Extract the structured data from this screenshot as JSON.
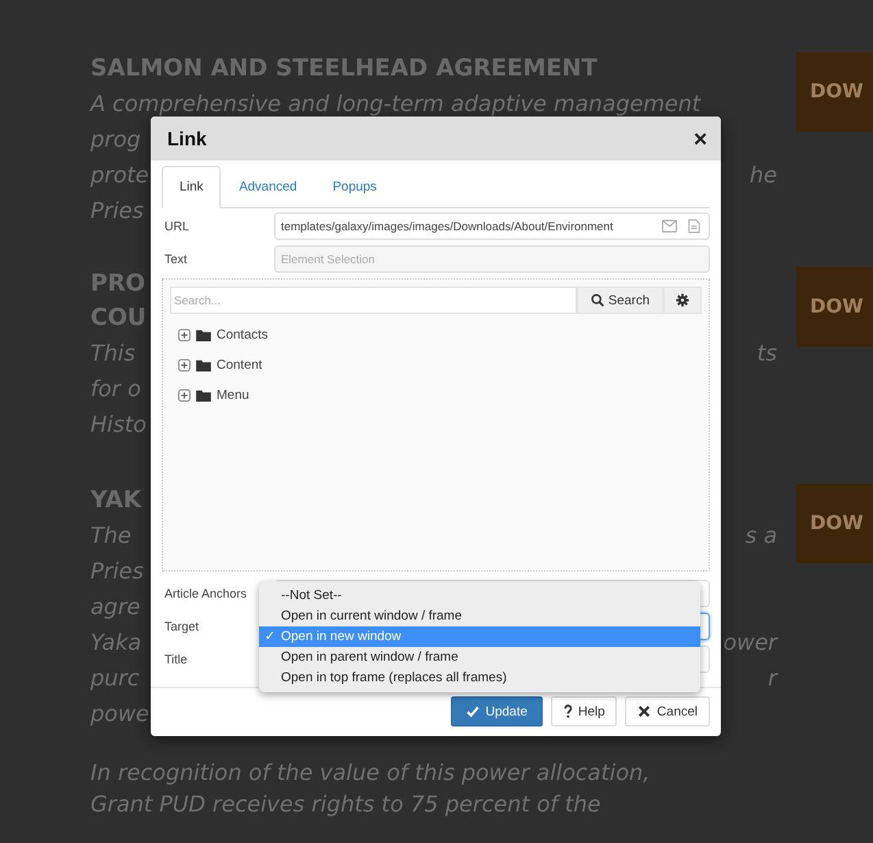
{
  "page": {
    "sections": [
      {
        "heading": [
          "SALMON AND STEELHEAD AGREEMENT"
        ],
        "lines": [
          {
            "left": "A comprehensive and long-term adaptive management"
          },
          {
            "left": "prog"
          },
          {
            "left": "prote",
            "right": "he"
          },
          {
            "left": "Pries"
          }
        ],
        "download": "DOW"
      },
      {
        "heading": [
          "PRO",
          "COU"
        ],
        "lines": [
          {
            "left": "This",
            "right": "ts"
          },
          {
            "left": "for o"
          },
          {
            "left": "Histo"
          }
        ],
        "download": "DOW"
      },
      {
        "heading": [
          "YAK"
        ],
        "lines": [
          {
            "left": "The",
            "right": "s a"
          },
          {
            "left": "Pries"
          },
          {
            "left": "agre"
          },
          {
            "left": "Yaka",
            "right": "ower"
          },
          {
            "left": "purc",
            "right": "r"
          },
          {
            "left": "powe"
          }
        ],
        "download": "DOW"
      }
    ],
    "closing_lines": [
      "In recognition of the value of this power allocation,",
      "Grant PUD receives rights to 75 percent of the"
    ]
  },
  "dialog": {
    "title": "Link",
    "close": "×",
    "tabs": [
      {
        "label": "Link",
        "selected": true
      },
      {
        "label": "Advanced",
        "selected": false
      },
      {
        "label": "Popups",
        "selected": false
      }
    ],
    "url": {
      "label": "URL",
      "value": "templates/galaxy/images/images/Downloads/About/Environment"
    },
    "text": {
      "label": "Text",
      "placeholder": "Element Selection"
    },
    "browser": {
      "search_placeholder": "Search...",
      "search_button": "Search",
      "tree": [
        {
          "label": "Contacts",
          "expanded": false
        },
        {
          "label": "Content",
          "expanded": false
        },
        {
          "label": "Menu",
          "expanded": false
        }
      ]
    },
    "anchors": {
      "label": "Article Anchors"
    },
    "target": {
      "label": "Target",
      "focused": true
    },
    "title_field": {
      "label": "Title"
    },
    "dropdown": [
      {
        "label": "--Not Set--",
        "selected": false
      },
      {
        "label": "Open in current window / frame",
        "selected": false
      },
      {
        "label": "Open in new window",
        "selected": true
      },
      {
        "label": "Open in parent window / frame",
        "selected": false
      },
      {
        "label": "Open in top frame (replaces all frames)",
        "selected": false
      }
    ],
    "check_mark": "✓",
    "buttons": [
      {
        "kind": "confirm",
        "label": "Update"
      },
      {
        "kind": "help",
        "label": "Help"
      },
      {
        "kind": "cancel",
        "label": "Cancel"
      }
    ]
  }
}
